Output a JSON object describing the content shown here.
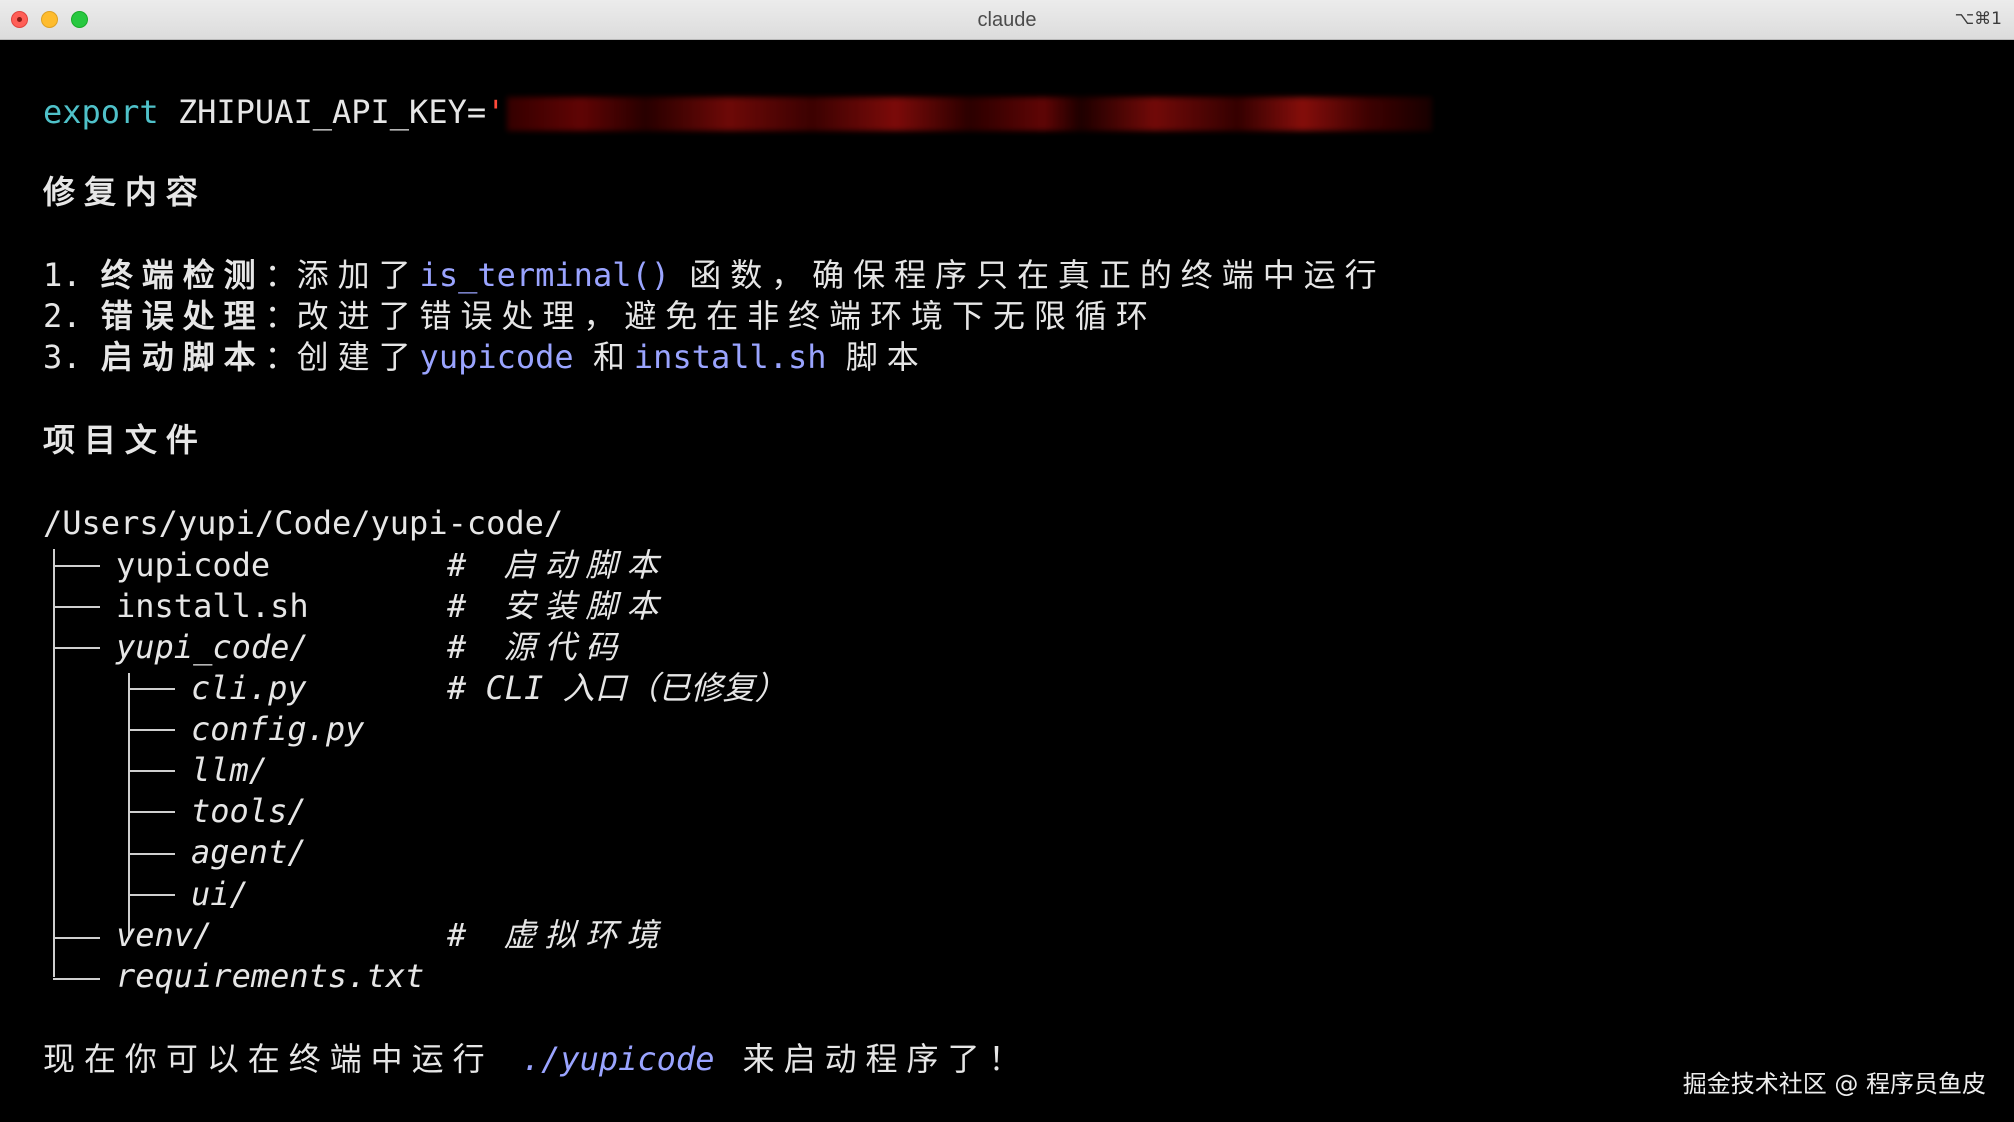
{
  "window": {
    "title": "claude",
    "shortcut": "⌥⌘1"
  },
  "colors": {
    "accent_keyword": "#4fc1c9",
    "code_text": "#9aa4ff",
    "redaction": "#7a0a08"
  },
  "export_line": {
    "keyword": "export",
    "text": " ZHIPUAI_API_KEY=",
    "quote": "'"
  },
  "fix": {
    "heading": "修复内容",
    "items": [
      {
        "num": "1. ",
        "title": "终端检测",
        "colon": "：",
        "pre": "添加了",
        "code": "is_terminal()",
        "post": "函数，确保程序只在真正的终端中运行"
      },
      {
        "num": "2. ",
        "title": "错误处理",
        "colon": "：",
        "pre": "改进了错误处理，避免在非终端环境下无限循环"
      },
      {
        "num": "3. ",
        "title": "启动脚本",
        "colon": "：",
        "pre": "创建了",
        "code": "yupicode",
        "mid": "和",
        "code2": "install.sh",
        "post": "脚本"
      }
    ]
  },
  "files": {
    "heading": "项目文件",
    "root": "/Users/yupi/Code/yupi-code/",
    "entries": [
      {
        "name": "yupicode",
        "comment": "# 启动脚本"
      },
      {
        "name": "install.sh",
        "comment": "# 安装脚本"
      },
      {
        "name": "yupi_code/",
        "comment": "# 源代码"
      },
      {
        "name": "cli.py",
        "comment": "# CLI 入口（已修复）"
      },
      {
        "name": "config.py"
      },
      {
        "name": "llm/"
      },
      {
        "name": "tools/"
      },
      {
        "name": "agent/"
      },
      {
        "name": "ui/"
      },
      {
        "name": "venv/",
        "comment": "# 虚拟环境"
      },
      {
        "name": "requirements.txt"
      }
    ]
  },
  "final": {
    "pre": "现在你可以在终端中运行 ",
    "code": "./yupicode",
    "post": " 来启动程序了！"
  },
  "watermark": "掘金技术社区 @ 程序员鱼皮"
}
